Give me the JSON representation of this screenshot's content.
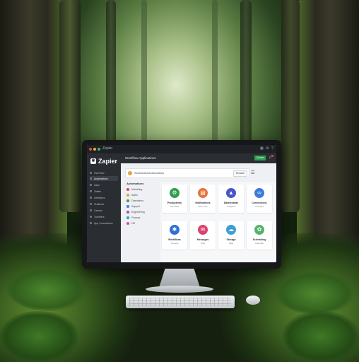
{
  "window": {
    "title": "Zapier"
  },
  "header": {
    "title": "Workflow Applications",
    "create_label": "Create"
  },
  "sidebar": {
    "logo_text": "Zapier",
    "items": [
      {
        "label": "Overview"
      },
      {
        "label": "Automations"
      },
      {
        "label": "Zaps"
      },
      {
        "label": "Tables"
      },
      {
        "label": "Interfaces"
      },
      {
        "label": "Chatbots"
      },
      {
        "label": "Canvas"
      },
      {
        "label": "Transfers"
      },
      {
        "label": "App Connections"
      }
    ]
  },
  "search": {
    "text": "Scheduled Automations",
    "button_label": "Browse"
  },
  "categories": {
    "title": "Automations",
    "items": [
      {
        "label": "Marketing",
        "color": "#e04545"
      },
      {
        "label": "Sales",
        "color": "#e2a23a"
      },
      {
        "label": "Operations",
        "color": "#3f9a4e"
      },
      {
        "label": "Support",
        "color": "#3b7dd8"
      },
      {
        "label": "Engineering",
        "color": "#8a56c8"
      },
      {
        "label": "Finance",
        "color": "#2fa7a0"
      },
      {
        "label": "HR",
        "color": "#d84f8b"
      }
    ]
  },
  "apps": [
    {
      "title": "Productivity",
      "subtitle": "Automate",
      "icon": "gear-icon",
      "color": "#2f9e4f",
      "glyph": "⚙"
    },
    {
      "title": "Notifications",
      "subtitle": "Alert tools",
      "icon": "bell-icon",
      "color": "#e8723a",
      "glyph": "▤"
    },
    {
      "title": "Dashboards",
      "subtitle": "Analytics",
      "icon": "chart-icon",
      "color": "#4a56c8",
      "glyph": "▲"
    },
    {
      "title": "Connections",
      "subtitle": "Link apps",
      "icon": "link-icon",
      "color": "#3b7dd8",
      "glyph": "∞"
    },
    {
      "title": "Workflows",
      "subtitle": "Process",
      "icon": "settings-icon",
      "color": "#2e6fd6",
      "glyph": "✱"
    },
    {
      "title": "Messages",
      "subtitle": "Chat",
      "icon": "chat-icon",
      "color": "#d8436f",
      "glyph": "✉"
    },
    {
      "title": "Storage",
      "subtitle": "Files",
      "icon": "cloud-icon",
      "color": "#3b9fd6",
      "glyph": "☁"
    },
    {
      "title": "Scheduling",
      "subtitle": "Calendar",
      "icon": "leaf-icon",
      "color": "#55b36a",
      "glyph": "✿"
    }
  ]
}
